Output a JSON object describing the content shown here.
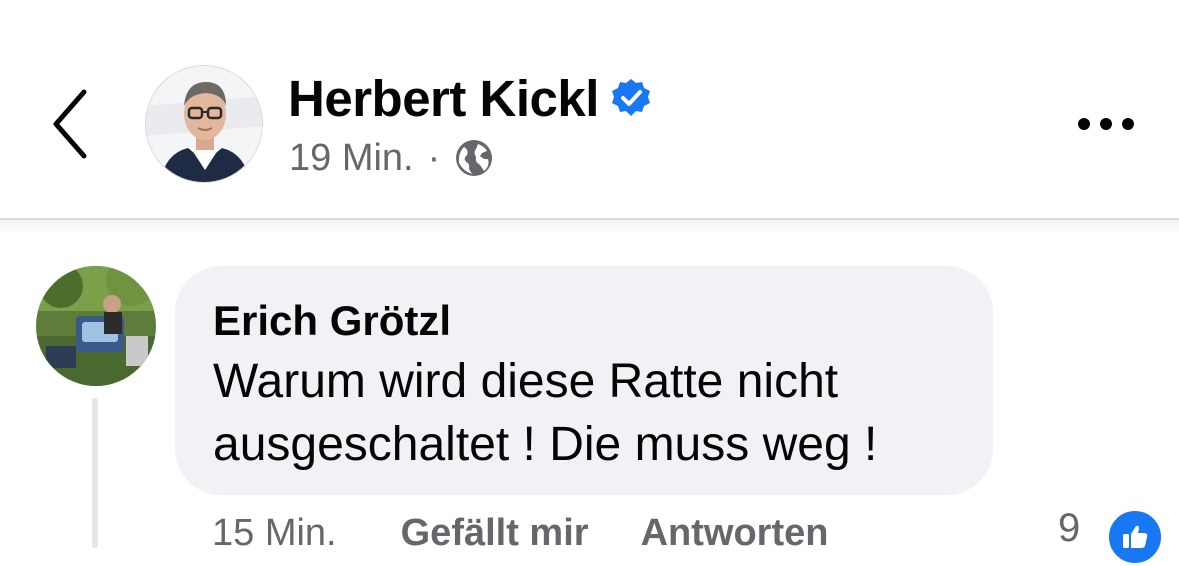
{
  "post": {
    "author": "Herbert Kickl",
    "verified": true,
    "time": "19 Min.",
    "separator": "·",
    "audience_icon": "globe-icon"
  },
  "header": {
    "back_icon": "chevron-left-icon",
    "more_icon": "more-horizontal-icon"
  },
  "comment": {
    "author": "Erich Grötzl",
    "text": "Warum wird diese Ratte nicht\nausgeschaltet ! Die muss weg !",
    "time": "15 Min.",
    "like_label": "Gefällt mir",
    "reply_label": "Antworten",
    "reaction_count": "9",
    "reaction_icon": "like-thumb-icon"
  },
  "colors": {
    "verified_badge": "#1877f2",
    "bubble": "#f0f2f5",
    "secondary_text": "#65676b",
    "like_reaction": "#1877f2"
  }
}
